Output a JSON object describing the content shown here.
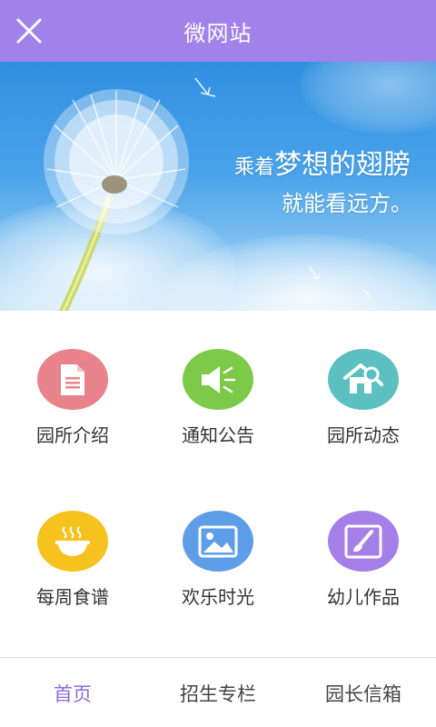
{
  "header": {
    "title": "微网站",
    "close_icon": "close-icon",
    "background_color": "#a181ea"
  },
  "banner": {
    "line1_small": "乘着",
    "line1_large": "梦想的翅膀",
    "line2": "就能看远方。"
  },
  "menu": {
    "items": [
      {
        "label": "园所介绍",
        "icon": "document-icon",
        "color": "#e8838b"
      },
      {
        "label": "通知公告",
        "icon": "megaphone-icon",
        "color": "#7dca4a"
      },
      {
        "label": "园所动态",
        "icon": "house-search-icon",
        "color": "#5cc0c1"
      },
      {
        "label": "每周食谱",
        "icon": "bowl-icon",
        "color": "#f5c21e"
      },
      {
        "label": "欢乐时光",
        "icon": "image-icon",
        "color": "#5e9ee9"
      },
      {
        "label": "幼儿作品",
        "icon": "paintbrush-icon",
        "color": "#a47fe8"
      }
    ]
  },
  "tabbar": {
    "tabs": [
      {
        "label": "首页",
        "active": true
      },
      {
        "label": "招生专栏",
        "active": false
      },
      {
        "label": "园长信箱",
        "active": false
      }
    ],
    "active_color": "#8b6cd9"
  }
}
